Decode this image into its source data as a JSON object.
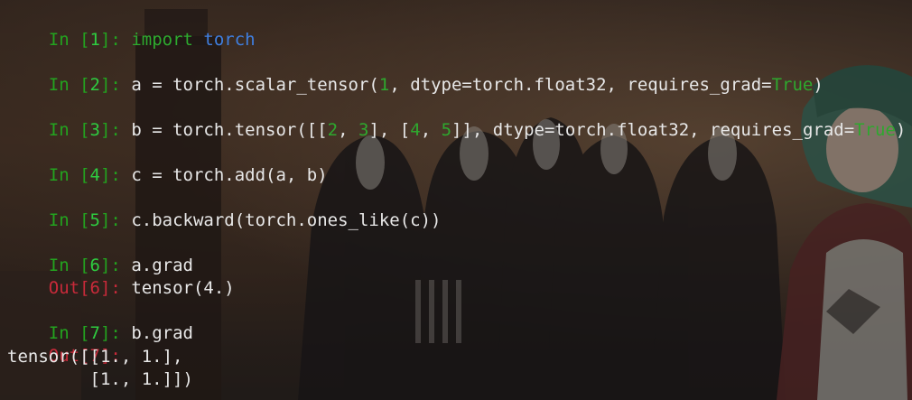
{
  "terminal": {
    "cells": [
      {
        "in_prompt": "In [",
        "in_number": "1",
        "in_close": "]:",
        "code": {
          "kw": "import",
          "module": "torch"
        }
      },
      {
        "in_prompt": "In [",
        "in_number": "2",
        "in_close": "]:",
        "code": {
          "pre": "a = torch.scalar_tensor(",
          "num1": "1",
          "mid": ", dtype=torch.float32, requires_grad=",
          "bool": "True",
          "post": ")"
        }
      },
      {
        "in_prompt": "In [",
        "in_number": "3",
        "in_close": "]:",
        "code": {
          "pre": "b = torch.tensor([[",
          "n1": "2",
          "s1": ", ",
          "n2": "3",
          "s2": "], [",
          "n3": "4",
          "s3": ", ",
          "n4": "5",
          "mid": "]], dtype=torch.float32, requires_grad=",
          "bool": "True",
          "post": ")"
        }
      },
      {
        "in_prompt": "In [",
        "in_number": "4",
        "in_close": "]:",
        "code": {
          "text": "c = torch.add(a, b)"
        }
      },
      {
        "in_prompt": "In [",
        "in_number": "5",
        "in_close": "]:",
        "code": {
          "text": "c.backward(torch.ones_like(c))"
        }
      },
      {
        "in_prompt": "In [",
        "in_number": "6",
        "in_close": "]:",
        "code": {
          "text": "a.grad"
        },
        "out_prompt": "Out[",
        "out_number": "6",
        "out_close": "]:",
        "output": "tensor(4.)"
      },
      {
        "in_prompt": "In [",
        "in_number": "7",
        "in_close": "]:",
        "code": {
          "text": "b.grad"
        },
        "out_prompt": "Out[",
        "out_number": "7",
        "out_close": "]:",
        "output_line1": "tensor([[1., 1.],",
        "output_line2": "        [1., 1.]])"
      }
    ]
  },
  "colors": {
    "prompt_in": "#23a31f",
    "prompt_out": "#c92a3a",
    "keyword": "#2eaa2e",
    "module": "#3f7fe0",
    "literal": "#2ea82e",
    "text": "#e8e8e8"
  },
  "background": {
    "icon": "anime-wallpaper-image"
  }
}
